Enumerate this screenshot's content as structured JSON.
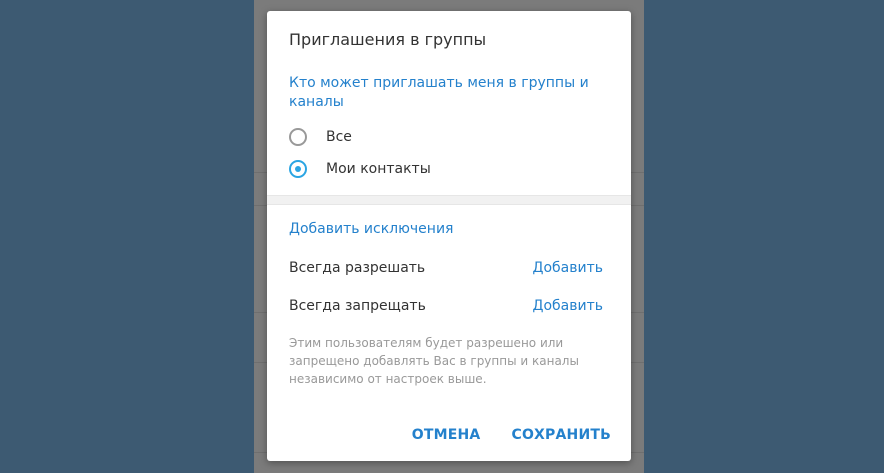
{
  "dialog": {
    "title": "Приглашения в группы",
    "who_header": "Кто может приглашать меня в группы и каналы",
    "options": [
      {
        "label": "Все",
        "checked": false
      },
      {
        "label": "Мои контакты",
        "checked": true
      }
    ],
    "exceptions_header": "Добавить исключения",
    "always_allow_label": "Всегда разрешать",
    "always_allow_action": "Добавить",
    "never_allow_label": "Всегда запрещать",
    "never_allow_action": "Добавить",
    "note": "Этим пользователям будет разрешено или запрещено добавлять Вас в группы и каналы независимо от настроек выше.",
    "cancel_label": "ОТМЕНА",
    "save_label": "СОХРАНИТЬ"
  },
  "colors": {
    "accent": "#2481cc",
    "radio_checked": "#2ba5e3",
    "background": "#3d5a72"
  }
}
